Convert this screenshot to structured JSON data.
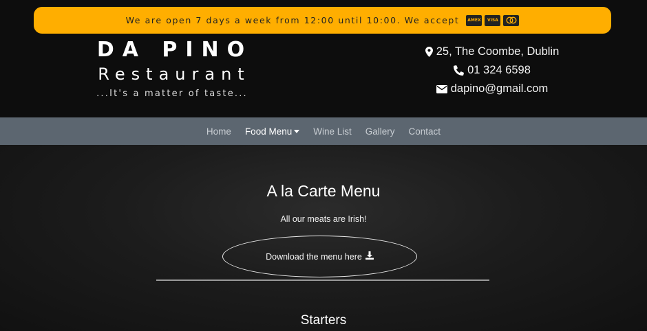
{
  "banner": {
    "text": "We are open 7 days a week from 12:00 until 10:00. We accept",
    "cards": [
      {
        "name": "american-express-card-icon",
        "label": "AMEX"
      },
      {
        "name": "visa-card-icon",
        "label": "VISA"
      },
      {
        "name": "mastercard-card-icon",
        "label": ""
      }
    ]
  },
  "brand": {
    "name": "DA PINO",
    "subtitle": "Restaurant",
    "tagline": "...It's a matter of taste..."
  },
  "contact": {
    "address": "25, The Coombe, Dublin",
    "phone": "01 324 6598",
    "email": "dapino@gmail.com"
  },
  "nav": {
    "home": "Home",
    "food_menu": "Food Menu",
    "wine_list": "Wine List",
    "gallery": "Gallery",
    "contact": "Contact"
  },
  "main": {
    "title": "A la Carte Menu",
    "note": "All our meats are Irish!",
    "download_label": "Download the menu here",
    "section_title": "Starters"
  },
  "colors": {
    "banner": "#ffae00",
    "navbar": "#5c6670",
    "header": "#0d0d0d"
  }
}
